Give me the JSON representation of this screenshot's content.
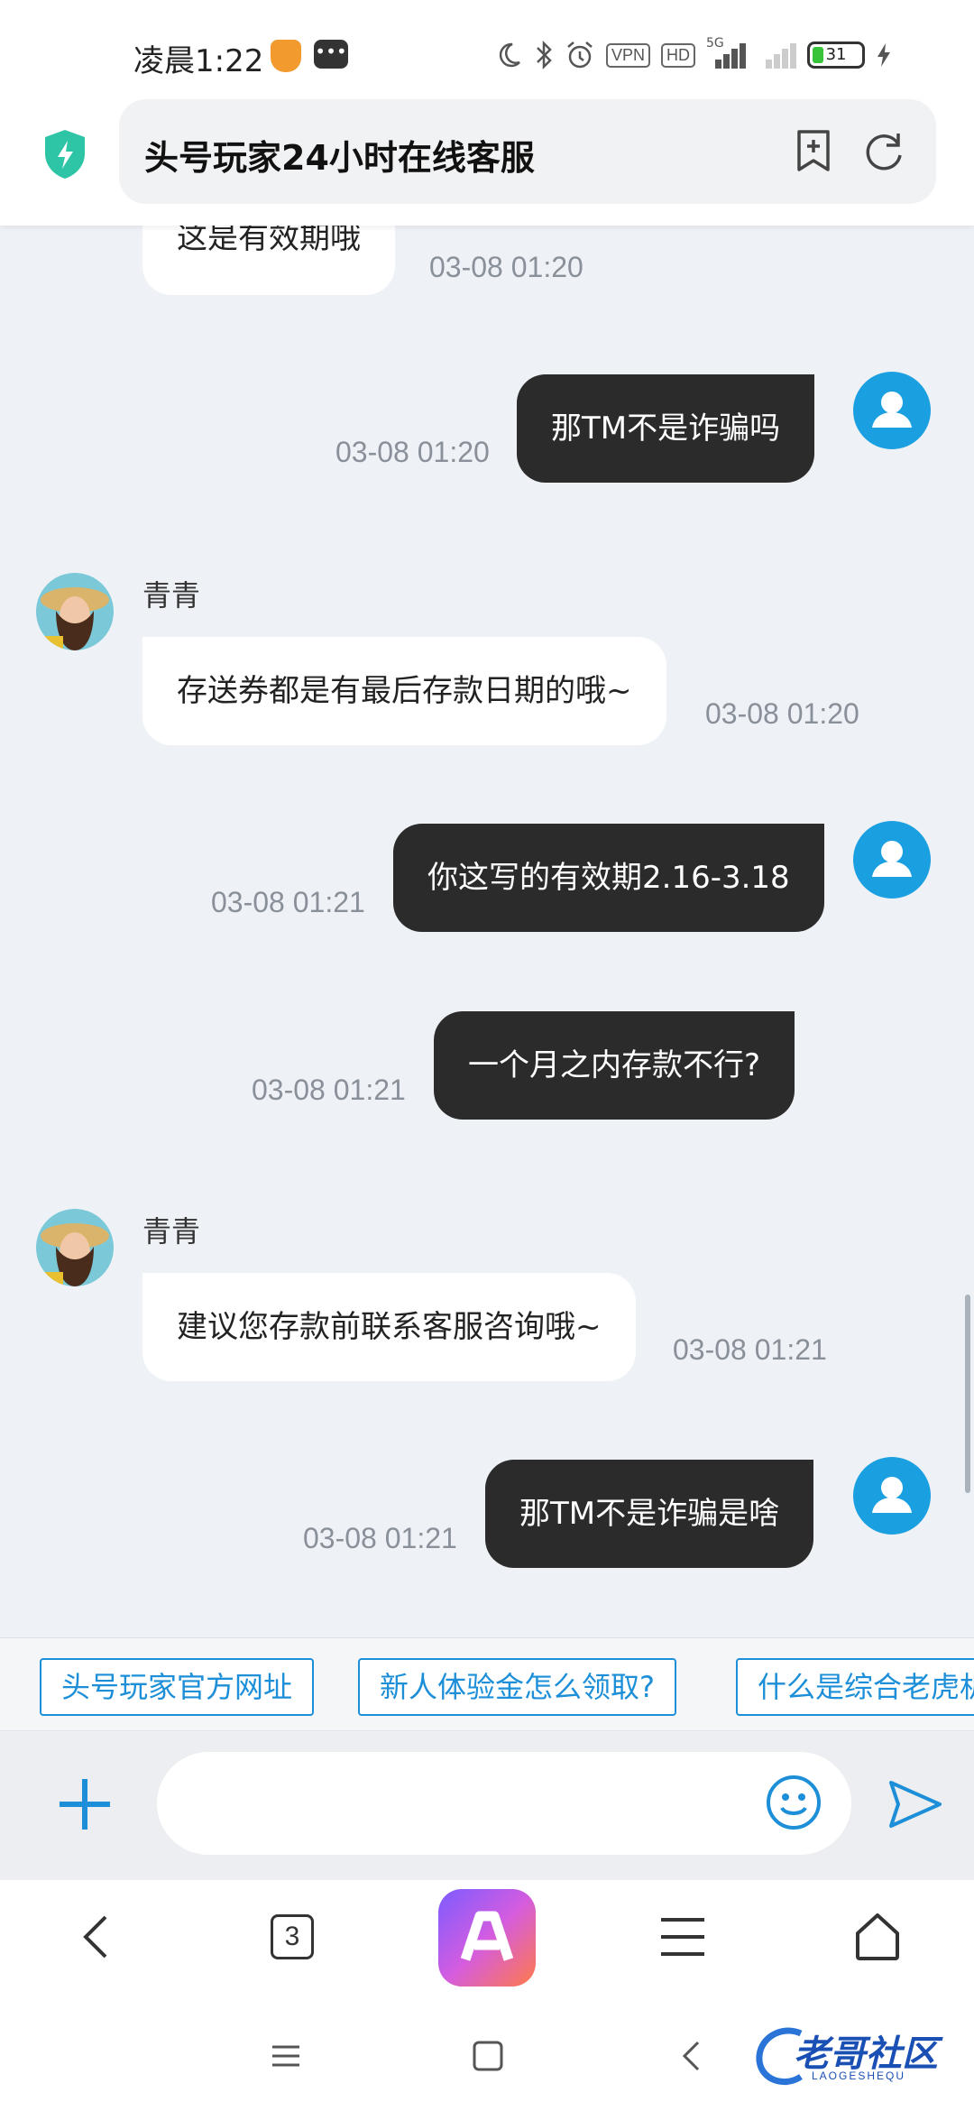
{
  "status_bar": {
    "time": "凌晨1:22",
    "vpn_label": "VPN",
    "hd_label": "HD",
    "network_label": "5G",
    "battery_level": "31"
  },
  "address_bar": {
    "title": "头号玩家24小时在线客服"
  },
  "chat": {
    "messages": [
      {
        "direction": "in",
        "text": "这是有效期哦",
        "time": "03-08 01:20"
      },
      {
        "direction": "out",
        "text": "那TM不是诈骗吗",
        "time": "03-08 01:20"
      },
      {
        "direction": "in",
        "sender": "青青",
        "text": "存送券都是有最后存款日期的哦~",
        "time": "03-08 01:20"
      },
      {
        "direction": "out",
        "text": "你这写的有效期2.16-3.18",
        "time": "03-08 01:21"
      },
      {
        "direction": "out",
        "text": "一个月之内存款不行?",
        "time": "03-08 01:21"
      },
      {
        "direction": "in",
        "sender": "青青",
        "text": "建议您存款前联系客服咨询哦~",
        "time": "03-08 01:21"
      },
      {
        "direction": "out",
        "text": "那TM不是诈骗是啥",
        "time": "03-08 01:21"
      }
    ]
  },
  "quick_replies": [
    "头号玩家官方网址",
    "新人体验金怎么领取?",
    "什么是综合老虎机"
  ],
  "input": {
    "value": "",
    "placeholder": ""
  },
  "browser_nav": {
    "tab_count": "3"
  },
  "watermark": {
    "text": "老哥社区",
    "sub": "LAOGESHEQU"
  },
  "colors": {
    "accent": "#1c8fd8",
    "out_bubble": "#2b2b2b",
    "in_bubble": "#ffffff",
    "chat_bg": "#eef2f6",
    "user_avatar": "#1a9fe0",
    "shield": "#2ec4a6"
  }
}
